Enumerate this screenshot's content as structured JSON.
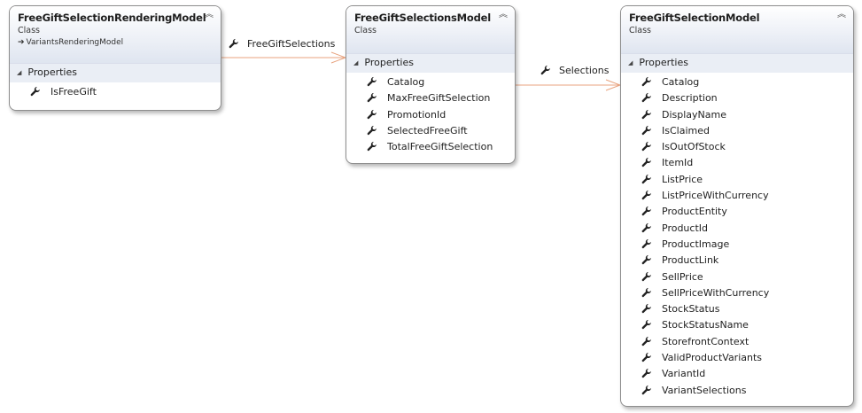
{
  "classes": [
    {
      "name": "FreeGiftSelectionRenderingModel",
      "kind": "Class",
      "inherits": "VariantsRenderingModel",
      "section": "Properties",
      "properties": [
        "IsFreeGift"
      ]
    },
    {
      "name": "FreeGiftSelectionsModel",
      "kind": "Class",
      "section": "Properties",
      "properties": [
        "Catalog",
        "MaxFreeGiftSelection",
        "PromotionId",
        "SelectedFreeGift",
        "TotalFreeGiftSelection"
      ]
    },
    {
      "name": "FreeGiftSelectionModel",
      "kind": "Class",
      "section": "Properties",
      "properties": [
        "Catalog",
        "Description",
        "DisplayName",
        "IsClaimed",
        "IsOutOfStock",
        "ItemId",
        "ListPrice",
        "ListPriceWithCurrency",
        "ProductEntity",
        "ProductId",
        "ProductImage",
        "ProductLink",
        "SellPrice",
        "SellPriceWithCurrency",
        "StockStatus",
        "StockStatusName",
        "StorefrontContext",
        "ValidProductVariants",
        "VariantId",
        "VariantSelections"
      ]
    }
  ],
  "associations": [
    {
      "label": "FreeGiftSelections",
      "from": "FreeGiftSelectionRenderingModel",
      "to": "FreeGiftSelectionsModel"
    },
    {
      "label": "Selections",
      "from": "FreeGiftSelectionsModel",
      "to": "FreeGiftSelectionModel"
    }
  ],
  "colors": {
    "connector": "#e8a37f",
    "header_gradient_end": "#dfe5f0",
    "section_bg": "#eaeef5",
    "border": "#8e8e8e"
  },
  "icons": {
    "property": "wrench-icon",
    "collapse": "double-chevron-up-icon",
    "section_toggle": "triangle-expanded-icon",
    "inherits": "inheritance-arrow-icon"
  }
}
